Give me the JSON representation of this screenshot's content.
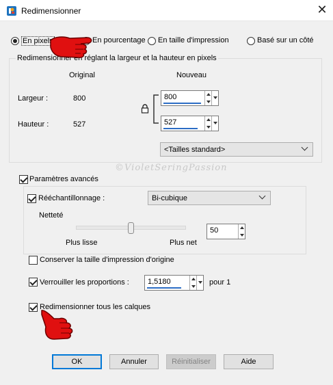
{
  "window": {
    "title": "Redimensionner",
    "close_glyph": "✕"
  },
  "mode_radios": [
    {
      "label": "En pixels",
      "checked": true
    },
    {
      "label": "En pourcentage",
      "checked": false
    },
    {
      "label": "En taille d'impression",
      "checked": false
    },
    {
      "label": "Basé sur un côté",
      "checked": false
    }
  ],
  "pixel_group": {
    "legend": "Redimensionner en réglant la largeur et la hauteur en pixels",
    "col_original": "Original",
    "col_nouveau": "Nouveau",
    "largeur_label": "Largeur :",
    "largeur_original": "800",
    "largeur_nouveau": "800",
    "hauteur_label": "Hauteur :",
    "hauteur_original": "527",
    "hauteur_nouveau": "527",
    "standard_sizes": "<Tailles standard>",
    "lock_icon": "lock-icon"
  },
  "advanced": {
    "label": "Paramètres avancés",
    "checked": true,
    "resample_label": "Rééchantillonnage :",
    "resample_checked": true,
    "resample_value": "Bi-cubique",
    "sharpness_label": "Netteté",
    "sharpness_value": "50",
    "slider_min_label": "Plus lisse",
    "slider_max_label": "Plus net",
    "slider_fraction": 0.5,
    "keep_print_label": "Conserver la taille d'impression d'origine",
    "keep_print_checked": false,
    "lock_ratio_label": "Verrouiller les proportions :",
    "lock_ratio_checked": true,
    "ratio_value": "1,5180",
    "ratio_suffix": "pour 1",
    "all_layers_label": "Redimensionner tous les calques",
    "all_layers_checked": true
  },
  "watermark": "©VioletSeringPassion",
  "buttons": {
    "ok": "OK",
    "cancel": "Annuler",
    "reset": "Réinitialiser",
    "help": "Aide"
  },
  "colors": {
    "accent": "#0078d7",
    "pointer_hand": "#e01010"
  }
}
